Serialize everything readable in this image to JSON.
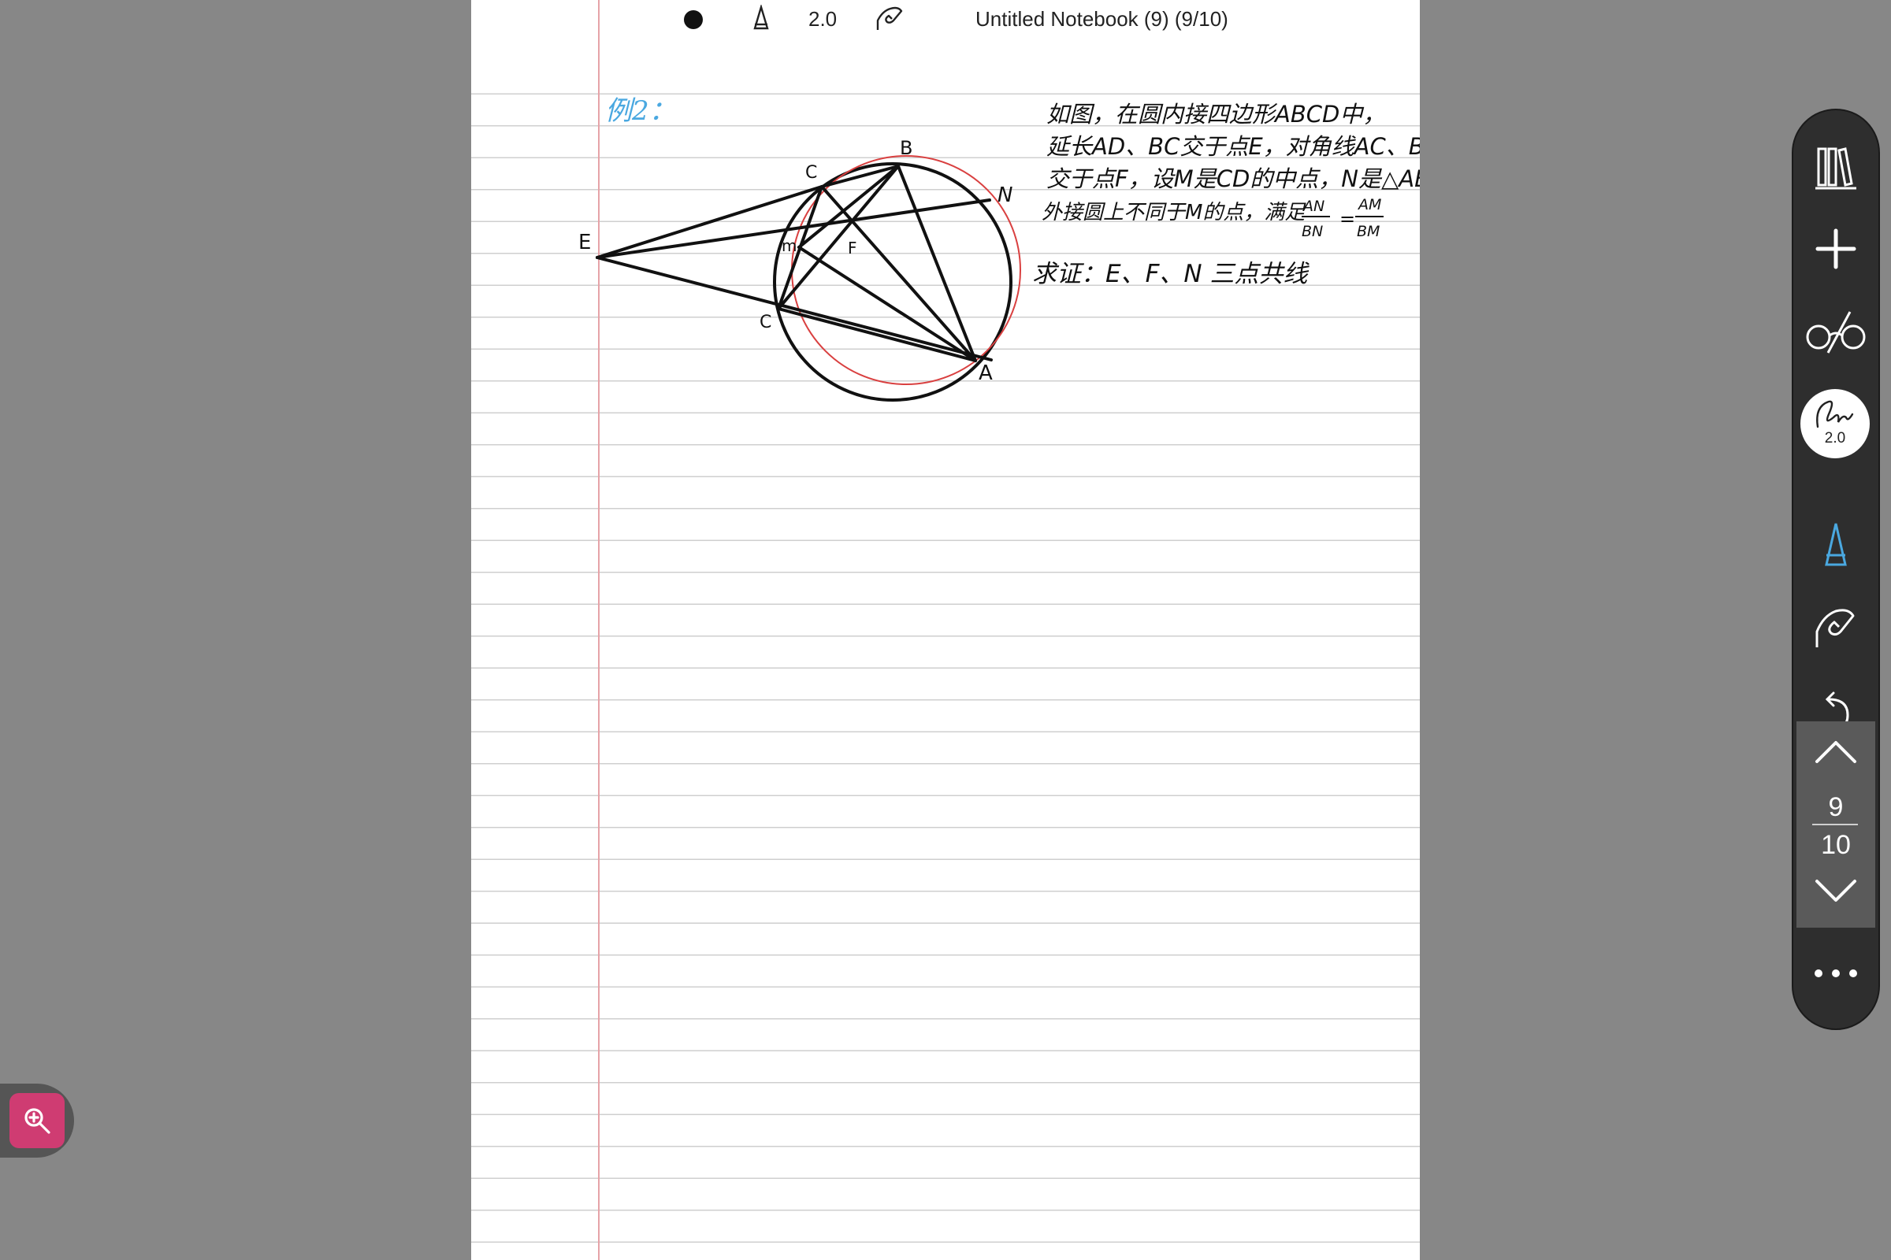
{
  "toolbar": {
    "pen_width": "2.0",
    "title": "Untitled Notebook (9) (9/10)"
  },
  "note": {
    "example_label": "例2：",
    "problem_lines": [
      "如图，在圆内接四边形ABCD中，",
      "延长AD、BC交于点E，对角线AC、BD",
      "交于点F，设M是CD的中点，N是△ABM",
      "外接圆上不同于M的点，满足"
    ],
    "ratio_left_num": "AN",
    "ratio_left_den": "BN",
    "ratio_equals": "=",
    "ratio_right_num": "AM",
    "ratio_right_den": "BM",
    "prove": "求证：E、F、N 三点共线",
    "points": {
      "A": "A",
      "B": "B",
      "C_top": "C",
      "C_bottom": "C",
      "E": "E",
      "F": "F",
      "M": "m",
      "N": "N"
    }
  },
  "sidebar": {
    "brush_width": "2.0",
    "page_current": "9",
    "page_total": "10"
  },
  "colors": {
    "background": "#878787",
    "paper": "#ffffff",
    "ruled_line": "#cfcfcf",
    "margin_line": "#e6a3a8",
    "ink": "#111111",
    "ink_blue": "#4aa8e0",
    "ink_red": "#d94040",
    "sidebar": "#2e2e2e",
    "accent_pink": "#cf3c72"
  },
  "icons": {
    "library": "library-icon",
    "add": "plus-icon",
    "glasses": "glasses-icon",
    "pen": "pen-icon",
    "shape": "hand-shape-icon",
    "undo": "undo-icon",
    "page_up": "chevron-up-icon",
    "page_down": "chevron-down-icon",
    "more": "more-icon",
    "zoom": "zoom-in-icon"
  }
}
